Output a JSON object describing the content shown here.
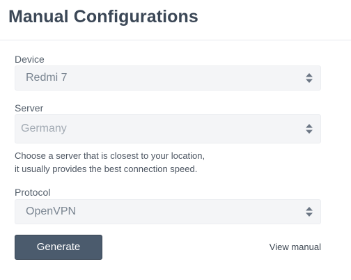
{
  "header": {
    "title": "Manual Configurations"
  },
  "form": {
    "device": {
      "label": "Device",
      "value": "Redmi 7"
    },
    "server": {
      "label": "Server",
      "value": "Germany"
    },
    "helper": {
      "line1": "Choose a server that is closest to your location,",
      "line2": "it usually provides the best connection speed."
    },
    "protocol": {
      "label": "Protocol",
      "value": "OpenVPN"
    }
  },
  "actions": {
    "generate_label": "Generate",
    "view_manual_label": "View manual"
  },
  "colors": {
    "title": "#3b4756",
    "button_bg": "#4b5b6d",
    "select_bg": "#f4f5f7",
    "caret": "#6b7684"
  },
  "icons": {
    "select_caret": "sort-updown-icon"
  }
}
